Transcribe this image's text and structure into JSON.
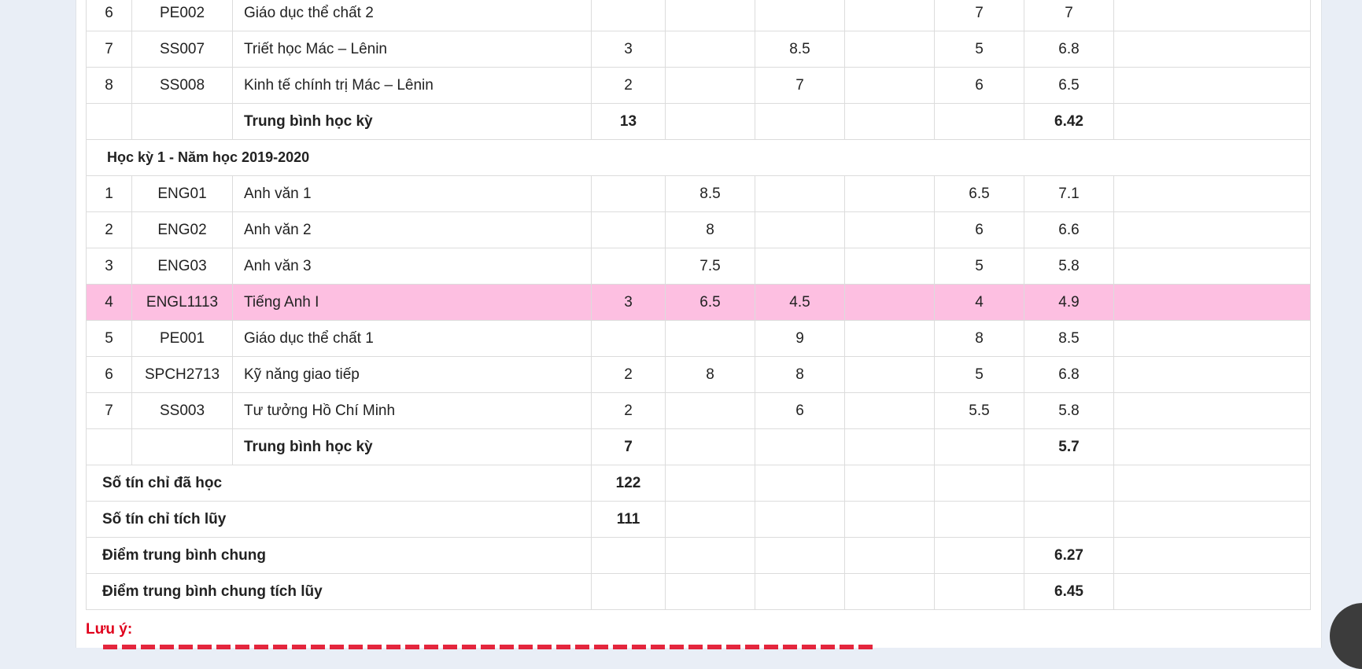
{
  "semester_prev_rows": [
    {
      "stt": "6",
      "code": "PE002",
      "name": "Giáo dục thể chất 2",
      "credits": "",
      "c1": "",
      "c2": "",
      "c3": "",
      "exam": "7",
      "total": "7",
      "extra": ""
    },
    {
      "stt": "7",
      "code": "SS007",
      "name": "Triết học Mác – Lênin",
      "credits": "3",
      "c1": "",
      "c2": "8.5",
      "c3": "",
      "exam": "5",
      "total": "6.8",
      "extra": ""
    },
    {
      "stt": "8",
      "code": "SS008",
      "name": "Kinh tế chính trị Mác – Lênin",
      "credits": "2",
      "c1": "",
      "c2": "7",
      "c3": "",
      "exam": "6",
      "total": "6.5",
      "extra": ""
    }
  ],
  "semester_prev_summary": {
    "label": "Trung bình học kỳ",
    "credits": "13",
    "total": "6.42"
  },
  "semester_1": {
    "title": "Học kỳ 1 - Năm học 2019-2020",
    "rows": [
      {
        "stt": "1",
        "code": "ENG01",
        "name": "Anh văn 1",
        "credits": "",
        "c1": "8.5",
        "c2": "",
        "c3": "",
        "exam": "6.5",
        "total": "7.1",
        "extra": ""
      },
      {
        "stt": "2",
        "code": "ENG02",
        "name": "Anh văn 2",
        "credits": "",
        "c1": "8",
        "c2": "",
        "c3": "",
        "exam": "6",
        "total": "6.6",
        "extra": ""
      },
      {
        "stt": "3",
        "code": "ENG03",
        "name": "Anh văn 3",
        "credits": "",
        "c1": "7.5",
        "c2": "",
        "c3": "",
        "exam": "5",
        "total": "5.8",
        "extra": ""
      },
      {
        "stt": "4",
        "code": "ENGL1113",
        "name": "Tiếng Anh I",
        "credits": "3",
        "c1": "6.5",
        "c2": "4.5",
        "c3": "",
        "exam": "4",
        "total": "4.9",
        "extra": ""
      },
      {
        "stt": "5",
        "code": "PE001",
        "name": "Giáo dục thể chất 1",
        "credits": "",
        "c1": "",
        "c2": "9",
        "c3": "",
        "exam": "8",
        "total": "8.5",
        "extra": ""
      },
      {
        "stt": "6",
        "code": "SPCH2713",
        "name": "Kỹ năng giao tiếp",
        "credits": "2",
        "c1": "8",
        "c2": "8",
        "c3": "",
        "exam": "5",
        "total": "6.8",
        "extra": ""
      },
      {
        "stt": "7",
        "code": "SS003",
        "name": "Tư tưởng Hồ Chí Minh",
        "credits": "2",
        "c1": "",
        "c2": "6",
        "c3": "",
        "exam": "5.5",
        "total": "5.8",
        "extra": ""
      }
    ],
    "summary": {
      "label": "Trung bình học kỳ",
      "credits": "7",
      "total": "5.7"
    }
  },
  "totals": {
    "credits_studied_label": "Số tín chỉ đã học",
    "credits_studied": "122",
    "credits_accumulated_label": "Số tín chỉ tích lũy",
    "credits_accumulated": "111",
    "gpa_label": "Điểm trung bình chung",
    "gpa": "6.27",
    "gpa_cumulative_label": "Điểm trung bình chung tích lũy",
    "gpa_cumulative": "6.45"
  },
  "note": {
    "label": "Lưu ý:"
  },
  "colors": {
    "highlight_row": "#fdbfe1",
    "note": "#e0001b"
  },
  "icons": {
    "scroll_top": "scroll-top-icon"
  }
}
